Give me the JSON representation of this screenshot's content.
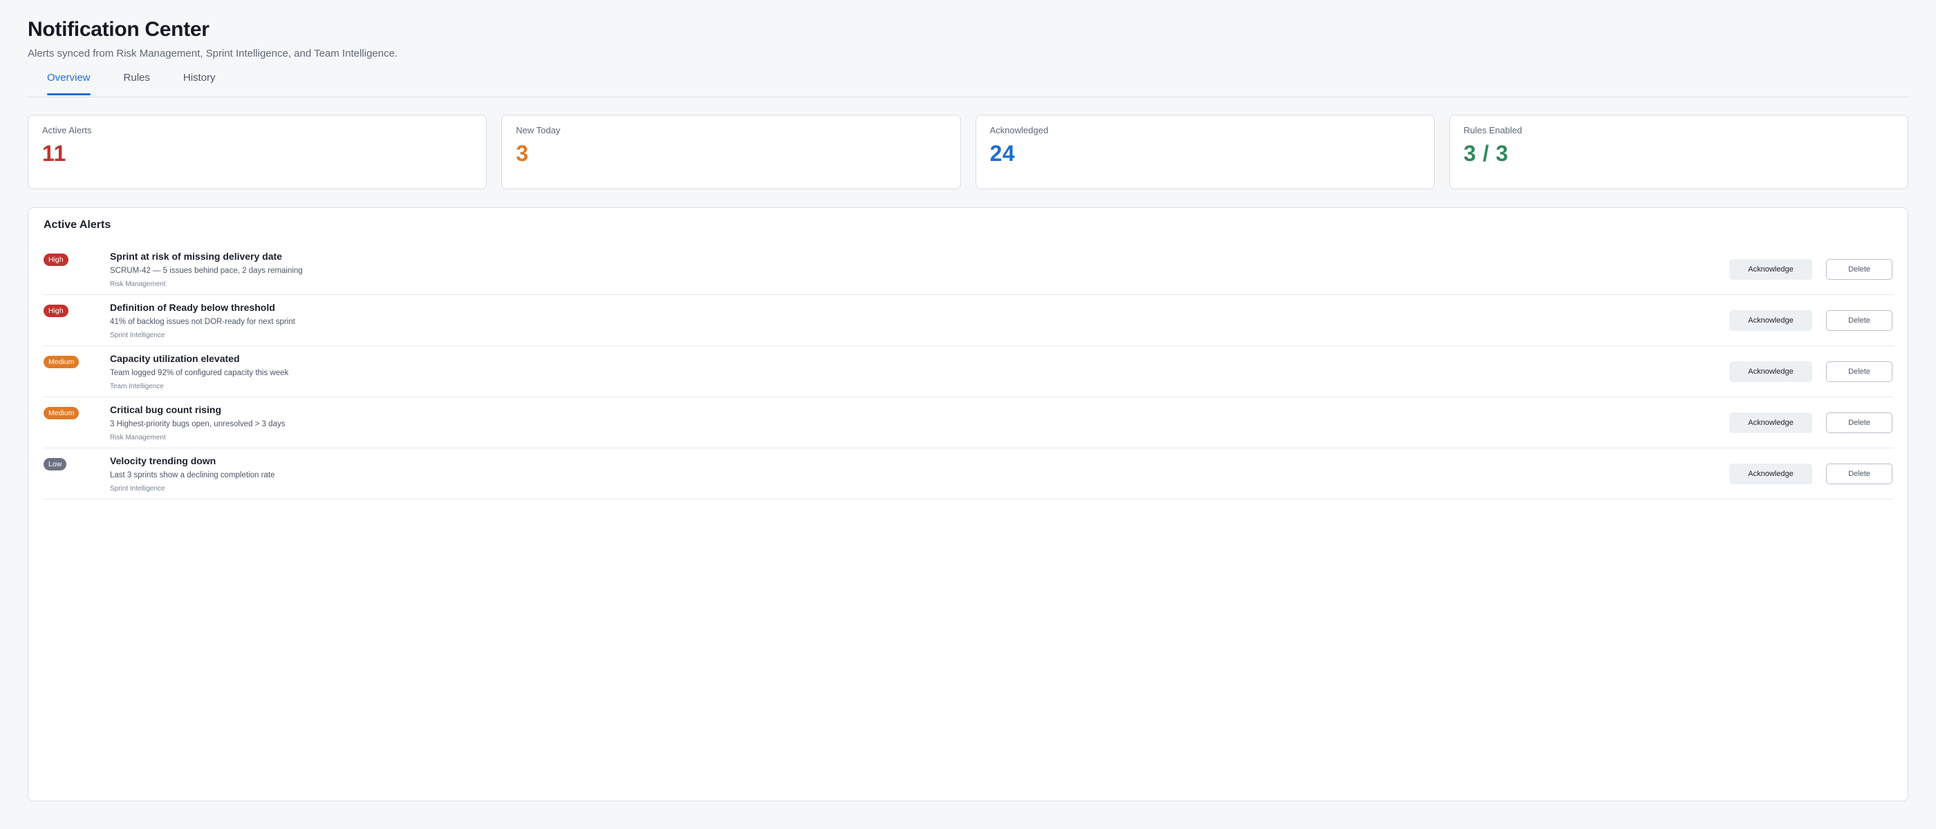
{
  "header": {
    "title": "Notification Center",
    "subtitle": "Alerts synced from Risk Management, Sprint Intelligence, and Team Intelligence."
  },
  "tabs": [
    {
      "label": "Overview",
      "active": true
    },
    {
      "label": "Rules",
      "active": false
    },
    {
      "label": "History",
      "active": false
    }
  ],
  "stats": [
    {
      "label": "Active Alerts",
      "value": "11",
      "color": "#c2312f"
    },
    {
      "label": "New Today",
      "value": "3",
      "color": "#e07a26"
    },
    {
      "label": "Acknowledged",
      "value": "24",
      "color": "#1f6ed4"
    },
    {
      "label": "Rules Enabled",
      "value": "3 / 3",
      "color": "#2e8b5e"
    }
  ],
  "alerts_panel": {
    "title": "Active Alerts",
    "acknowledge_label": "Acknowledge",
    "delete_label": "Delete",
    "items": [
      {
        "severity": "High",
        "severity_color": "#c2312f",
        "title": "Sprint at risk of missing delivery date",
        "description": "SCRUM-42 — 5 issues behind pace, 2 days remaining",
        "source": "Risk Management"
      },
      {
        "severity": "High",
        "severity_color": "#c2312f",
        "title": "Definition of Ready below threshold",
        "description": "41% of backlog issues not DOR-ready for next sprint",
        "source": "Sprint Intelligence"
      },
      {
        "severity": "Medium",
        "severity_color": "#e07a26",
        "title": "Capacity utilization elevated",
        "description": "Team logged 92% of configured capacity this week",
        "source": "Team Intelligence"
      },
      {
        "severity": "Medium",
        "severity_color": "#e07a26",
        "title": "Critical bug count rising",
        "description": "3 Highest-priority bugs open, unresolved > 3 days",
        "source": "Risk Management"
      },
      {
        "severity": "Low",
        "severity_color": "#6b7280",
        "title": "Velocity trending down",
        "description": "Last 3 sprints show a declining completion rate",
        "source": "Sprint Intelligence"
      }
    ]
  }
}
